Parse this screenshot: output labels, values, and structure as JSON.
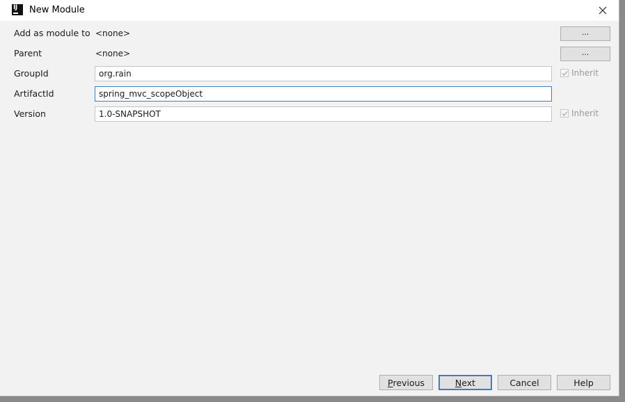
{
  "window": {
    "title": "New Module",
    "app_icon": "intellij-idea-icon",
    "app_icon_text": "IJ"
  },
  "form": {
    "add_as_module_to": {
      "label": "Add as module to",
      "value": "<none>",
      "button_label": "..."
    },
    "parent": {
      "label": "Parent",
      "value": "<none>",
      "button_label": "..."
    },
    "group_id": {
      "label": "GroupId",
      "value": "org.rain",
      "inherit_label": "Inherit",
      "inherit_checked": true
    },
    "artifact_id": {
      "label": "ArtifactId",
      "value": "spring_mvc_scopeObject"
    },
    "version": {
      "label": "Version",
      "value": "1.0-SNAPSHOT",
      "inherit_label": "Inherit",
      "inherit_checked": true
    }
  },
  "footer": {
    "previous": {
      "mnemonic": "P",
      "rest": "revious"
    },
    "next": {
      "mnemonic": "N",
      "rest": "ext"
    },
    "cancel": "Cancel",
    "help": "Help"
  },
  "colors": {
    "focus_border": "#3d7ec2",
    "dialog_bg": "#f2f2f2"
  }
}
